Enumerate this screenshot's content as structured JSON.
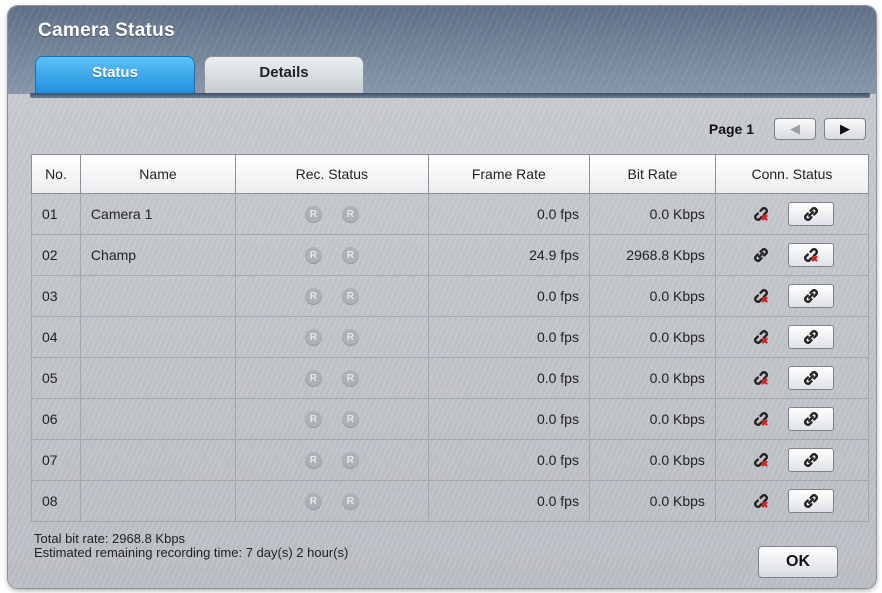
{
  "window": {
    "title": "Camera Status"
  },
  "tabs": [
    {
      "label": "Status",
      "active": true
    },
    {
      "label": "Details",
      "active": false
    }
  ],
  "pager": {
    "label": "Page 1"
  },
  "table": {
    "columns": [
      "No.",
      "Name",
      "Rec. Status",
      "Frame Rate",
      "Bit Rate",
      "Conn. Status"
    ],
    "rows": [
      {
        "no": "01",
        "name": "Camera 1",
        "rec": [
          "R",
          "R"
        ],
        "frame_rate": "0.0 fps",
        "bit_rate": "0.0 Kbps",
        "connected": false
      },
      {
        "no": "02",
        "name": "Champ",
        "rec": [
          "R",
          "R"
        ],
        "frame_rate": "24.9 fps",
        "bit_rate": "2968.8 Kbps",
        "connected": true
      },
      {
        "no": "03",
        "name": "",
        "rec": [
          "R",
          "R"
        ],
        "frame_rate": "0.0 fps",
        "bit_rate": "0.0 Kbps",
        "connected": false
      },
      {
        "no": "04",
        "name": "",
        "rec": [
          "R",
          "R"
        ],
        "frame_rate": "0.0 fps",
        "bit_rate": "0.0 Kbps",
        "connected": false
      },
      {
        "no": "05",
        "name": "",
        "rec": [
          "R",
          "R"
        ],
        "frame_rate": "0.0 fps",
        "bit_rate": "0.0 Kbps",
        "connected": false
      },
      {
        "no": "06",
        "name": "",
        "rec": [
          "R",
          "R"
        ],
        "frame_rate": "0.0 fps",
        "bit_rate": "0.0 Kbps",
        "connected": false
      },
      {
        "no": "07",
        "name": "",
        "rec": [
          "R",
          "R"
        ],
        "frame_rate": "0.0 fps",
        "bit_rate": "0.0 Kbps",
        "connected": false
      },
      {
        "no": "08",
        "name": "",
        "rec": [
          "R",
          "R"
        ],
        "frame_rate": "0.0 fps",
        "bit_rate": "0.0 Kbps",
        "connected": false
      }
    ]
  },
  "footer": {
    "total_bit_rate": "Total bit rate: 2968.8 Kbps",
    "remaining_time": "Estimated remaining recording time: 7 day(s) 2 hour(s)",
    "ok_label": "OK"
  },
  "icons": {
    "prev": "triangle-left-icon",
    "next": "triangle-right-icon",
    "connected": "link-icon",
    "disconnected": "broken-link-icon",
    "rec": "record-badge-icon"
  },
  "colors": {
    "active_tab": "#2a9ae6",
    "header": "#6f7f95",
    "broken_link_red": "#d42020"
  }
}
